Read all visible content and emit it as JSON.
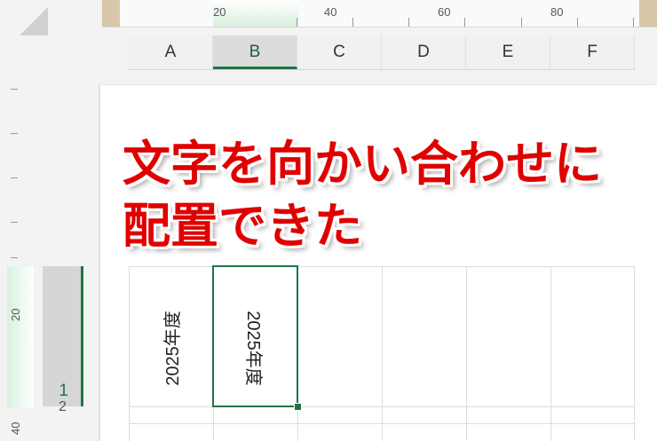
{
  "ruler_top": {
    "labels": [
      "20",
      "40",
      "60",
      "80"
    ]
  },
  "columns": [
    "A",
    "B",
    "C",
    "D",
    "E",
    "F"
  ],
  "selected_column": "B",
  "ruler_left": {
    "labels": [
      "20",
      "40"
    ]
  },
  "rows": [
    "1",
    "2"
  ],
  "title": {
    "line1": "文字を向かい合わせに",
    "line2": "配置できた"
  },
  "cells": {
    "A1": "2025年度",
    "B1": "2025年度"
  },
  "colors": {
    "accent": "#217346",
    "title": "#e00000"
  }
}
